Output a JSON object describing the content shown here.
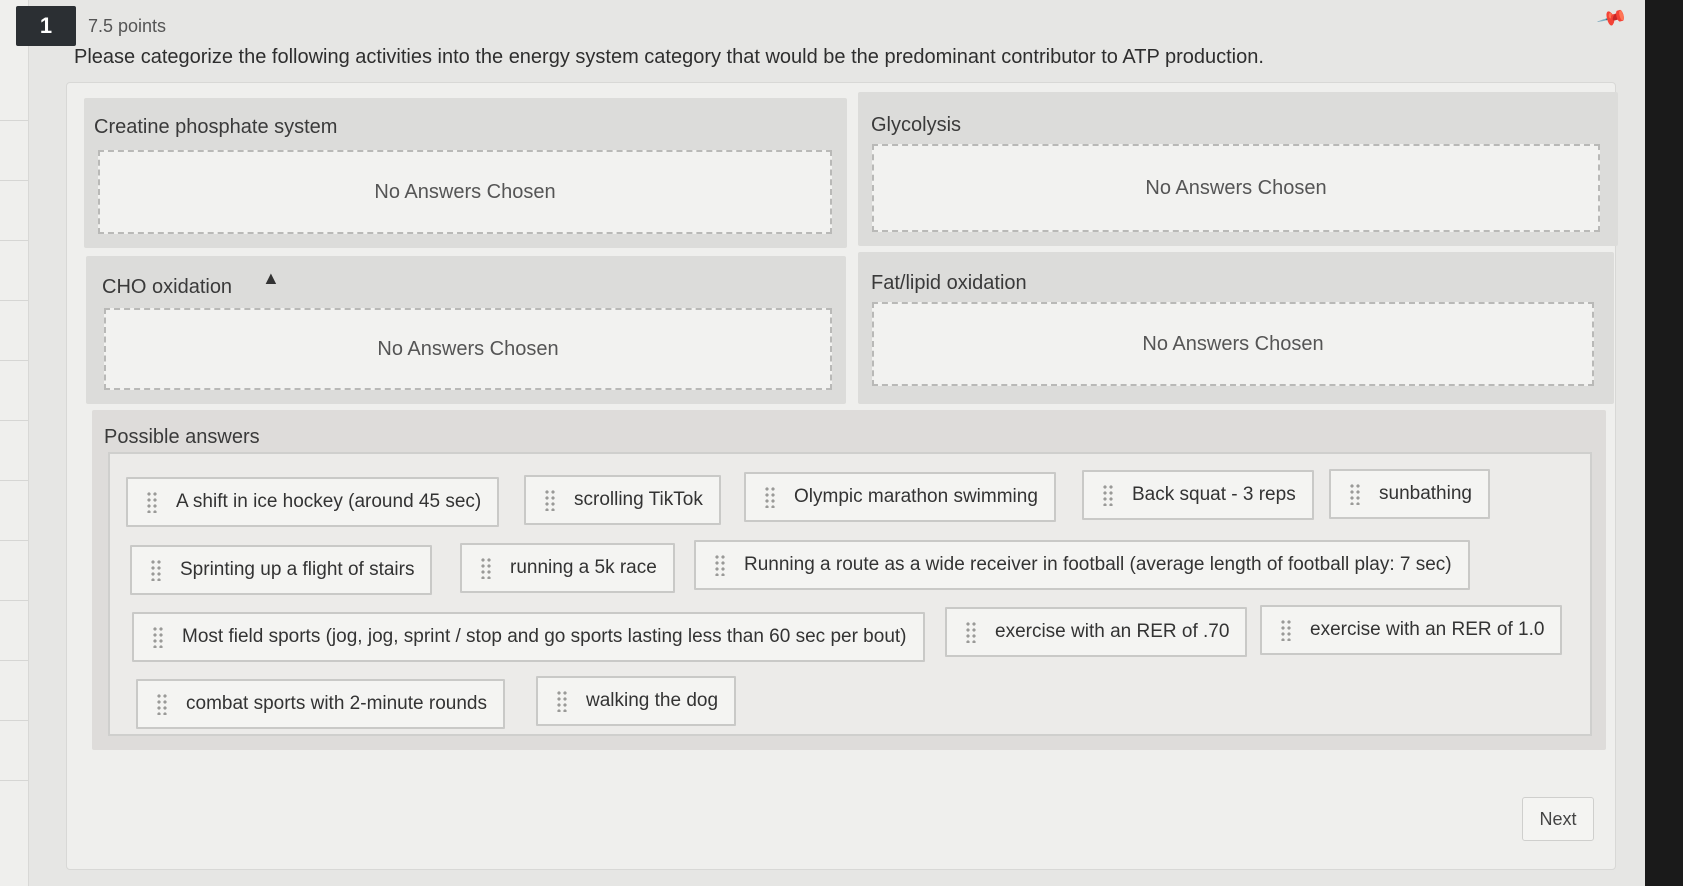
{
  "question": {
    "number": "1",
    "points": "7.5 points",
    "prompt": "Please categorize the following activities into the energy system category that would be the predominant contributor to ATP production."
  },
  "categories": [
    {
      "title": "Creatine phosphate system",
      "placeholder": "No Answers Chosen"
    },
    {
      "title": "Glycolysis",
      "placeholder": "No Answers Chosen"
    },
    {
      "title": "CHO oxidation",
      "placeholder": "No Answers Chosen"
    },
    {
      "title": "Fat/lipid oxidation",
      "placeholder": "No Answers Chosen"
    }
  ],
  "possible_answers": {
    "title": "Possible answers",
    "items": [
      "A shift in ice hockey (around 45 sec)",
      "scrolling TikTok",
      "Olympic marathon swimming",
      "Back squat - 3 reps",
      "sunbathing",
      "Sprinting up a flight of stairs",
      "running a 5k race",
      "Running a route as a wide receiver in football (average length of football play: 7 sec)",
      "Most field sports (jog, jog, sprint / stop and go sports lasting less than 60 sec per bout)",
      "exercise with an RER of .70",
      "exercise with an RER of 1.0",
      "combat sports with 2-minute rounds",
      "walking the dog"
    ]
  },
  "navigation": {
    "next_label": "Next"
  },
  "icons": {
    "pin": "pin-icon",
    "grip": "drag-handle-icon",
    "cursor": "mouse-pointer-icon"
  }
}
